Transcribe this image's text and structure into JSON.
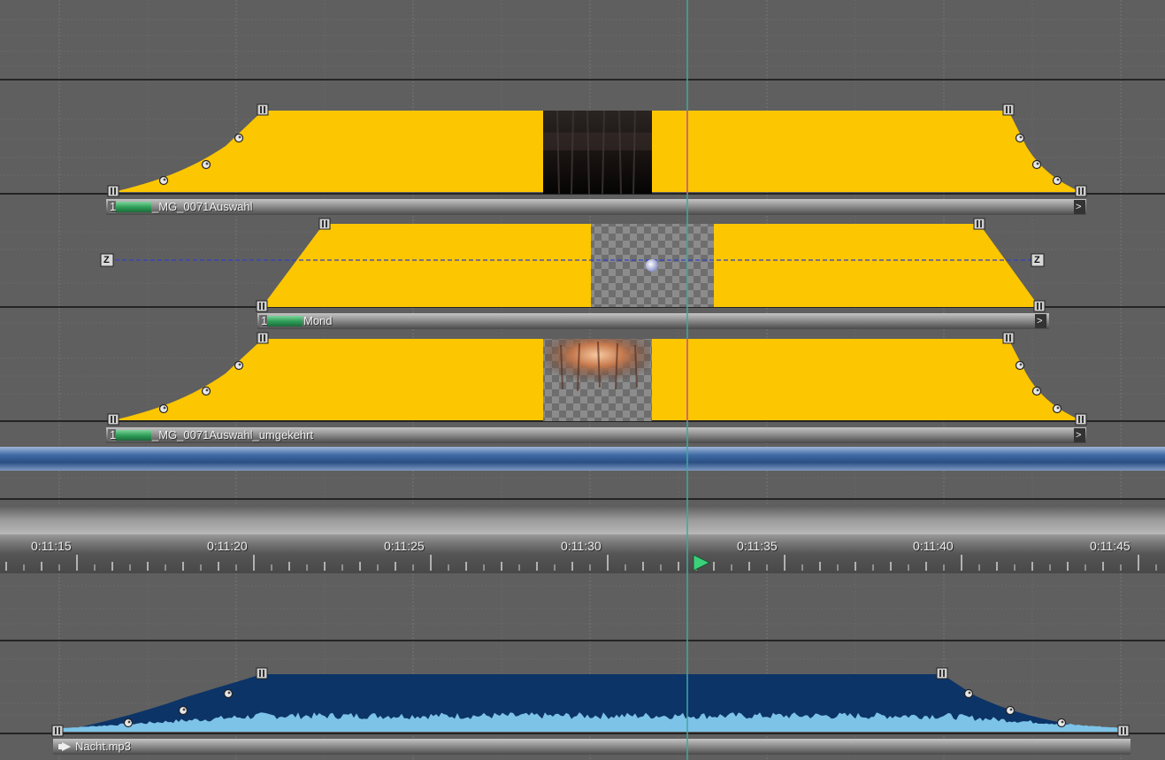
{
  "colors": {
    "background": "#5f5f5f",
    "video_envelope": "#fcc600",
    "audio_envelope": "#0c3467",
    "audio_waveform": "#7dc3e8",
    "playhead": "#40a8a0",
    "separator": "#4a78b0",
    "track_bar": "#8c8c8c",
    "label_green": "#2fa059"
  },
  "video_tracks": [
    {
      "track_number": "1",
      "clip_name": "_MG_0071Auswahl",
      "thumbnail": "dark-forest-thumbnail",
      "end_marker": ">"
    },
    {
      "track_number": "1",
      "clip_name": "Mond",
      "thumbnail": "transparent-moon-thumbnail",
      "end_marker": ">",
      "z_marker": "Z"
    },
    {
      "track_number": "1",
      "clip_name": "_MG_0071Auswahl_umgekehrt",
      "thumbnail": "sunset-forest-thumbnail",
      "end_marker": ">"
    }
  ],
  "timeline": {
    "labels": [
      "0:11:15",
      "0:11:20",
      "0:11:25",
      "0:11:30",
      "0:11:35",
      "0:11:40",
      "0:11:45"
    ],
    "playhead_icon": "play-triangle-icon"
  },
  "audio_track": {
    "clip_name": "Nacht.mp3",
    "icon": "audio-speaker-icon"
  }
}
